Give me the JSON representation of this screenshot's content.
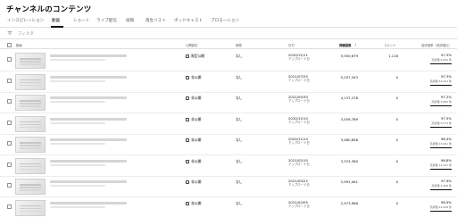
{
  "page": {
    "title": "チャンネルのコンテンツ"
  },
  "tabs": [
    {
      "label": "インスピレーション"
    },
    {
      "label": "動画"
    },
    {
      "label": "ショート"
    },
    {
      "label": "ライブ配信"
    },
    {
      "label": "投稿"
    },
    {
      "label": "再生リスト"
    },
    {
      "label": "ポッドキャスト"
    },
    {
      "label": "プロモーション"
    }
  ],
  "filter": {
    "label": "フィルタ"
  },
  "table": {
    "headers": {
      "video": "動画",
      "visibility": "公開設定",
      "restrictions": "制限",
      "date": "日付",
      "views": "視聴回数",
      "comments": "コメント",
      "likes": "高評価率（低評価比）"
    },
    "rows": [
      {
        "visibility": "限定公開",
        "restriction": "なし",
        "date": "2020/12/11",
        "date_sub": "アップロード日",
        "views": "5,550,679",
        "comments": "1,116",
        "like_pct": "97.5%",
        "like_count": "高評価 5,625 件",
        "like_ratio": 0.975
      },
      {
        "visibility": "非公開",
        "restriction": "なし",
        "date": "2021/07/20",
        "date_sub": "アップロード日",
        "views": "5,207,343",
        "comments": "0",
        "like_pct": "97.3%",
        "like_count": "高評価 33,441 件",
        "like_ratio": 0.973
      },
      {
        "visibility": "非公開",
        "restriction": "なし",
        "date": "2021/05/30",
        "date_sub": "アップロード日",
        "views": "4,137,278",
        "comments": "0",
        "like_pct": "97.2%",
        "like_count": "高評価 3,865 件",
        "like_ratio": 0.972
      },
      {
        "visibility": "非公開",
        "restriction": "なし",
        "date": "2020/12/10",
        "date_sub": "アップロード日",
        "views": "3,559,789",
        "comments": "0",
        "like_pct": "97.5%",
        "like_count": "高評価 5,574 件",
        "like_ratio": 0.975
      },
      {
        "visibility": "非公開",
        "restriction": "なし",
        "date": "2020/11/14",
        "date_sub": "アップロード日",
        "views": "3,480,858",
        "comments": "0",
        "like_pct": "98.4%",
        "like_count": "高評価 23,061 件",
        "like_ratio": 0.984
      },
      {
        "visibility": "非公開",
        "restriction": "なし",
        "date": "2021/02/10",
        "date_sub": "アップロード日",
        "views": "3,374,380",
        "comments": "0",
        "like_pct": "98.8%",
        "like_count": "高評価 12,447 件",
        "like_ratio": 0.988
      },
      {
        "visibility": "非公開",
        "restriction": "なし",
        "date": "2021/05/22",
        "date_sub": "アップロード日",
        "views": "2,991,061",
        "comments": "0",
        "like_pct": "97.9%",
        "like_count": "高評価 4,568 件",
        "like_ratio": 0.979
      },
      {
        "visibility": "非公開",
        "restriction": "なし",
        "date": "2021/02/05",
        "date_sub": "アップロード日",
        "views": "2,973,986",
        "comments": "0",
        "like_pct": "98.9%",
        "like_count": "高評価 24,228 件",
        "like_ratio": 0.989
      }
    ]
  },
  "icons": {
    "filter": "filter-icon",
    "visibility": "lock-icon"
  }
}
